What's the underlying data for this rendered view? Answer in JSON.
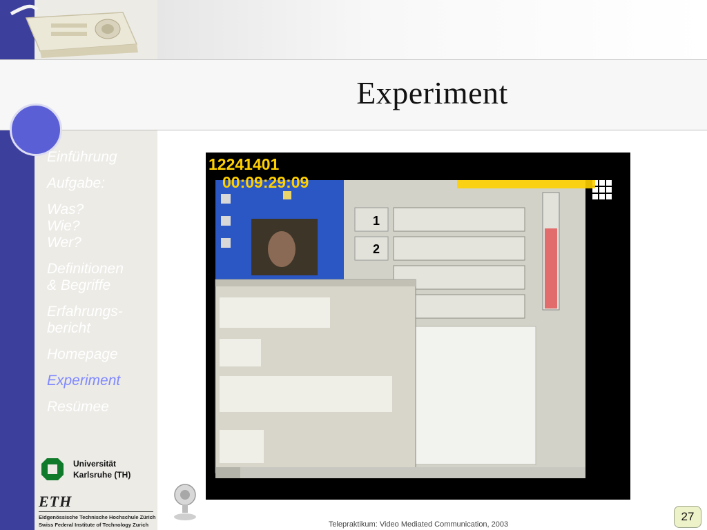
{
  "slide": {
    "title": "Experiment",
    "footer": "Telepraktikum: Video Mediated Communication, 2003",
    "page_number": "27"
  },
  "nav": {
    "items": [
      {
        "label": "Einführung",
        "active": false
      },
      {
        "label": "Aufgabe:",
        "active": false
      },
      {
        "label": "Was?\nWie?\nWer?",
        "active": false
      },
      {
        "label": "Definitionen\n& Begriffe",
        "active": false
      },
      {
        "label": "Erfahrungs-\nbericht",
        "active": false
      },
      {
        "label": "Homepage",
        "active": false
      },
      {
        "label": "Experiment",
        "active": true
      },
      {
        "label": "Resümee",
        "active": false
      }
    ]
  },
  "logos": {
    "universitaet_line1": "Universität",
    "universitaet_line2": "Karlsruhe (TH)",
    "eth_mark": "ETH",
    "eth_line1": "Eidgenössische Technische Hochschule Zürich",
    "eth_line2": "Swiss Federal Institute of Technology Zurich"
  },
  "screenshot": {
    "id_number": "12241401",
    "timer": "00:09:29:09",
    "row_labels": [
      "1",
      "2"
    ]
  },
  "colors": {
    "accent_stripe": "#3d3f9d",
    "active_nav": "#7f88ff",
    "counter_yellow": "#ffd000"
  }
}
